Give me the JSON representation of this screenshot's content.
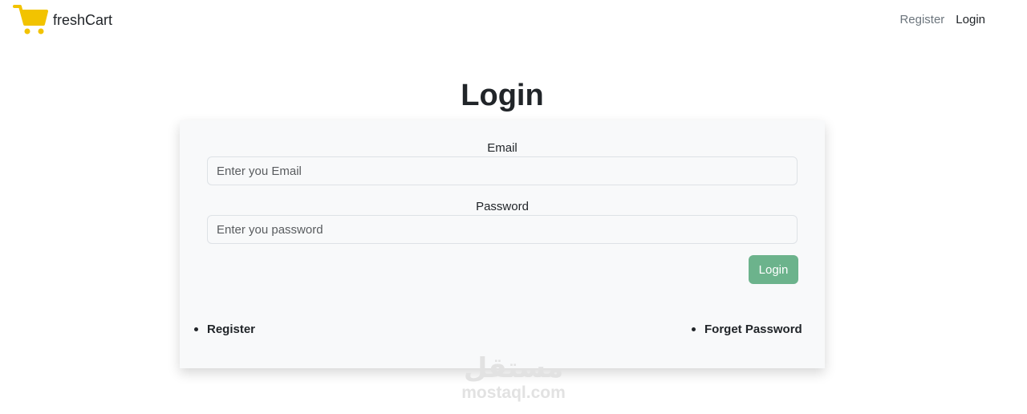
{
  "navbar": {
    "brand_name": "freshCart",
    "links": [
      {
        "label": "Register"
      },
      {
        "label": "Login"
      }
    ]
  },
  "page": {
    "title": "Login"
  },
  "form": {
    "email_label": "Email",
    "email_placeholder": "Enter you Email",
    "email_value": "",
    "password_label": "Password",
    "password_placeholder": "Enter you password",
    "password_value": "",
    "submit_label": "Login"
  },
  "footer_links": {
    "register": "Register",
    "forget_password": "Forget Password"
  },
  "watermark": {
    "logo_text": "مستقل",
    "site": "mostaql.com"
  },
  "icons": {
    "brand": "cart-icon"
  },
  "colors": {
    "brand_cart": "#f2c300",
    "login_button": "#6cb38c",
    "card_background": "#f8f9fa"
  }
}
